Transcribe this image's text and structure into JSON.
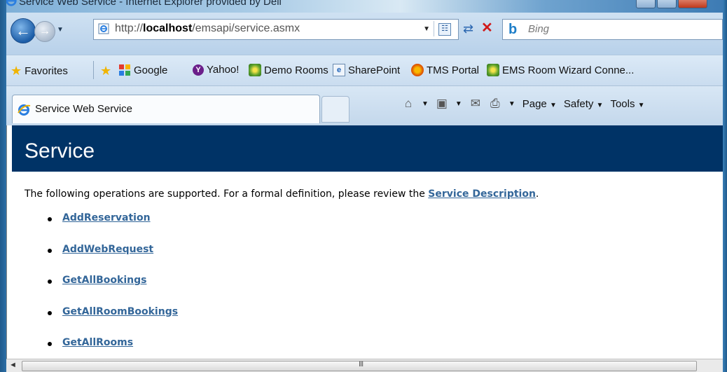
{
  "window": {
    "title": "Service Web Service - Internet Explorer provided by Dell"
  },
  "address_bar": {
    "url_prefix": "http://",
    "url_host": "localhost",
    "url_path": "/emsapi/service.asmx"
  },
  "search": {
    "placeholder": "Bing"
  },
  "favorites_bar": {
    "favorites_label": "Favorites",
    "links": [
      "Google",
      "Yahoo!",
      "Demo Rooms",
      "SharePoint",
      "TMS Portal",
      "EMS Room Wizard Conne..."
    ]
  },
  "tabs": {
    "active_title": "Service Web Service"
  },
  "command_bar": {
    "page_label": "Page",
    "safety_label": "Safety",
    "tools_label": "Tools"
  },
  "page": {
    "heading": "Service",
    "intro_text": "The following operations are supported. For a formal definition, please review the ",
    "service_description_link": "Service Description",
    "intro_end": ".",
    "operations": [
      "AddReservation",
      "AddWebRequest",
      "GetAllBookings",
      "GetAllRoomBookings",
      "GetAllRooms"
    ]
  },
  "colors": {
    "heading_band": "#003366",
    "link": "#336699"
  }
}
